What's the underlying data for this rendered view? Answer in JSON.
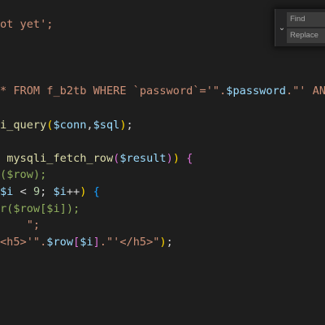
{
  "editor": {
    "lines": [
      [
        {
          "t": "ot yet';",
          "c": "tok-str"
        }
      ],
      [],
      [],
      [],
      [
        {
          "t": "* FROM f_b2tb WHERE `password`='\".",
          "c": "tok-str"
        },
        {
          "t": "$password",
          "c": "tok-var"
        },
        {
          "t": ".\"' AN",
          "c": "tok-str"
        }
      ],
      [],
      [
        {
          "t": "i_query",
          "c": "tok-fn"
        },
        {
          "t": "(",
          "c": "tok-br1"
        },
        {
          "t": "$conn",
          "c": "tok-var"
        },
        {
          "t": ",",
          "c": "tok-punc"
        },
        {
          "t": "$sql",
          "c": "tok-var"
        },
        {
          "t": ")",
          "c": "tok-br1"
        },
        {
          "t": ";",
          "c": "tok-punc"
        }
      ],
      [],
      [
        {
          "t": " ",
          "c": "tok-punc"
        },
        {
          "t": "mysqli_fetch_row",
          "c": "tok-fn"
        },
        {
          "t": "(",
          "c": "tok-br2"
        },
        {
          "t": "$result",
          "c": "tok-var"
        },
        {
          "t": ")",
          "c": "tok-br2"
        },
        {
          "t": ") ",
          "c": "tok-br1"
        },
        {
          "t": "{",
          "c": "tok-br2"
        }
      ],
      [
        {
          "t": "(",
          "c": "tok-faded-str"
        },
        {
          "t": "$row",
          "c": "tok-faded-str"
        },
        {
          "t": ");",
          "c": "tok-faded-str"
        }
      ],
      [
        {
          "t": "$i",
          "c": "tok-var"
        },
        {
          "t": " < ",
          "c": "tok-punc"
        },
        {
          "t": "9",
          "c": "tok-num"
        },
        {
          "t": "; ",
          "c": "tok-punc"
        },
        {
          "t": "$i",
          "c": "tok-var"
        },
        {
          "t": "++",
          "c": "tok-punc"
        },
        {
          "t": ") ",
          "c": "tok-br1"
        },
        {
          "t": "{",
          "c": "tok-br3"
        }
      ],
      [
        {
          "t": "r(",
          "c": "tok-faded-str"
        },
        {
          "t": "$row[$i]",
          "c": "tok-faded-str"
        },
        {
          "t": ");",
          "c": "tok-faded-str"
        }
      ],
      [
        {
          "t": "    \";",
          "c": "tok-str"
        }
      ],
      [
        {
          "t": "<h5>'\".",
          "c": "tok-str"
        },
        {
          "t": "$row",
          "c": "tok-var"
        },
        {
          "t": "[",
          "c": "tok-br2"
        },
        {
          "t": "$i",
          "c": "tok-var"
        },
        {
          "t": "]",
          "c": "tok-br2"
        },
        {
          "t": ".\"'</h5>\"",
          "c": "tok-str"
        },
        {
          "t": ")",
          "c": "tok-br1"
        },
        {
          "t": ";",
          "c": "tok-punc"
        }
      ]
    ]
  },
  "find_widget": {
    "find_placeholder": "Find",
    "replace_placeholder": "Replace",
    "toggle_icon": "chevron-down-icon"
  },
  "colors": {
    "background": "#1e1e1e",
    "string": "#ce9178",
    "keyword": "#569cd6",
    "variable": "#9cdcfe",
    "function": "#dcdcaa",
    "bracket_gold": "#ffd700",
    "bracket_orchid": "#da70d6",
    "bracket_blue": "#179fff"
  }
}
